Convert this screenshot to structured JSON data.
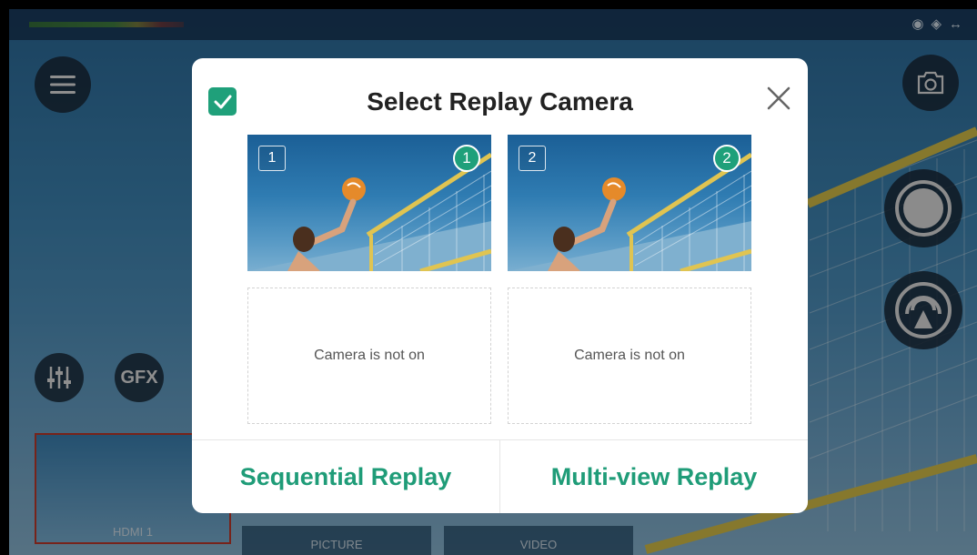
{
  "dialog": {
    "title": "Select Replay Camera",
    "cameras": [
      {
        "number": "1",
        "badge": "1"
      },
      {
        "number": "2",
        "badge": "2"
      }
    ],
    "empty_slots": [
      "Camera is not on",
      "Camera is not on"
    ],
    "buttons": {
      "sequential": "Sequential Replay",
      "multiview": "Multi-view Replay"
    }
  },
  "background": {
    "gfx_label": "GFX",
    "sources": [
      "HDMI 1",
      "PICTURE",
      "VIDEO"
    ]
  },
  "colors": {
    "accent": "#1fa07a",
    "record_selected_border": "#c0392b"
  }
}
